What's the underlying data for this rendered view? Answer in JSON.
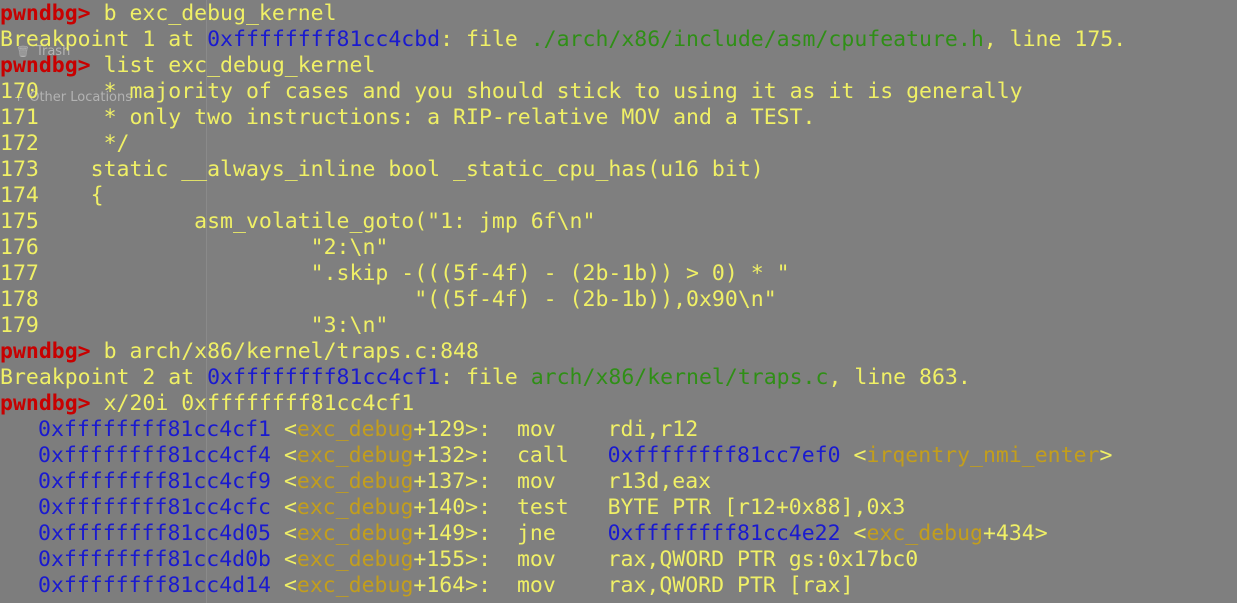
{
  "file_manager_ghost": {
    "trash": {
      "icon": "trash-icon",
      "label": "Trash"
    },
    "other_locations": {
      "icon": "plus-icon",
      "label": "Other Locations"
    }
  },
  "colors": {
    "background": "#7f7f7f",
    "prompt": "#c80000",
    "text": "#f0f066",
    "address": "#1a1acf",
    "filepath": "#2f8f16",
    "symbol": "#c39e1c"
  },
  "terminal": {
    "prompt": "pwndbg>",
    "cmd1": "b exc_debug_kernel",
    "bp1": {
      "pre": "Breakpoint 1 at ",
      "addr": "0xffffffff81cc4cbd",
      "mid": ": file ",
      "file": "./arch/x86/include/asm/cpufeature.h",
      "post": ", line 175."
    },
    "cmd2": "list exc_debug_kernel",
    "source": [
      {
        "num": "170",
        "text": "     * majority of cases and you should stick to using it as it is generally"
      },
      {
        "num": "171",
        "text": "     * only two instructions: a RIP-relative MOV and a TEST."
      },
      {
        "num": "172",
        "text": "     */"
      },
      {
        "num": "173",
        "text": "    static __always_inline bool _static_cpu_has(u16 bit)"
      },
      {
        "num": "174",
        "text": "    {"
      },
      {
        "num": "175",
        "text": "            asm_volatile_goto(\"1: jmp 6f\\n\""
      },
      {
        "num": "176",
        "text": "                     \"2:\\n\""
      },
      {
        "num": "177",
        "text": "                     \".skip -(((5f-4f) - (2b-1b)) > 0) * \""
      },
      {
        "num": "178",
        "text": "                             \"((5f-4f) - (2b-1b)),0x90\\n\""
      },
      {
        "num": "179",
        "text": "                     \"3:\\n\""
      }
    ],
    "cmd3": "b arch/x86/kernel/traps.c:848",
    "bp2": {
      "pre": "Breakpoint 2 at ",
      "addr": "0xffffffff81cc4cf1",
      "mid": ": file ",
      "file": "arch/x86/kernel/traps.c",
      "post": ", line 863."
    },
    "cmd4": "x/20i 0xffffffff81cc4cf1",
    "disasm": [
      {
        "addr": "0xffffffff81cc4cf1",
        "lt": " <",
        "sym": "exc_debug",
        "off": "+129>:",
        "gap": "  ",
        "mnem": "mov ",
        "pad": "   ",
        "ops": "rdi,r12"
      },
      {
        "addr": "0xffffffff81cc4cf4",
        "lt": " <",
        "sym": "exc_debug",
        "off": "+132>:",
        "gap": "  ",
        "mnem": "call",
        "pad": "   ",
        "ops_addr": "0xffffffff81cc7ef0",
        "ops_lt": " <",
        "ops_sym": "irqentry_nmi_enter",
        "ops_gt": ">"
      },
      {
        "addr": "0xffffffff81cc4cf9",
        "lt": " <",
        "sym": "exc_debug",
        "off": "+137>:",
        "gap": "  ",
        "mnem": "mov ",
        "pad": "   ",
        "ops": "r13d,eax"
      },
      {
        "addr": "0xffffffff81cc4cfc",
        "lt": " <",
        "sym": "exc_debug",
        "off": "+140>:",
        "gap": "  ",
        "mnem": "test",
        "pad": "   ",
        "ops": "BYTE PTR [r12+0x88],0x3"
      },
      {
        "addr": "0xffffffff81cc4d05",
        "lt": " <",
        "sym": "exc_debug",
        "off": "+149>:",
        "gap": "  ",
        "mnem": "jne ",
        "pad": "   ",
        "ops_addr": "0xffffffff81cc4e22",
        "ops_lt": " <",
        "ops_sym": "exc_debug",
        "ops_gt": "+434>"
      },
      {
        "addr": "0xffffffff81cc4d0b",
        "lt": " <",
        "sym": "exc_debug",
        "off": "+155>:",
        "gap": "  ",
        "mnem": "mov ",
        "pad": "   ",
        "ops": "rax,QWORD PTR gs:0x17bc0"
      },
      {
        "addr": "0xffffffff81cc4d14",
        "lt": " <",
        "sym": "exc_debug",
        "off": "+164>:",
        "gap": "  ",
        "mnem": "mov ",
        "pad": "   ",
        "ops": "rax,QWORD PTR [rax]"
      }
    ]
  }
}
